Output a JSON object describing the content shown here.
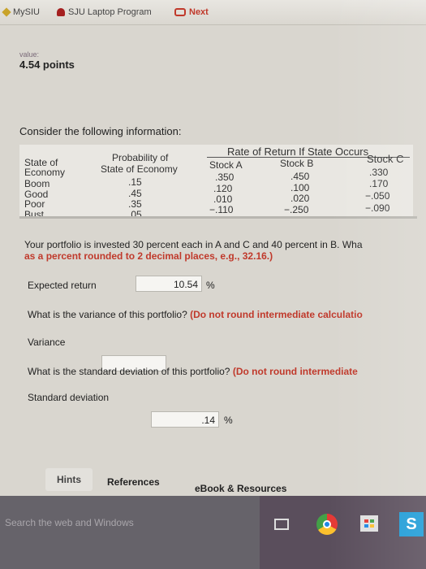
{
  "browser": {
    "tabs": [
      {
        "label": "MySIU"
      },
      {
        "label": "SJU Laptop Program"
      },
      {
        "label": "Next"
      }
    ]
  },
  "score": {
    "label": "value:",
    "value": "4.54 points"
  },
  "problem": {
    "intro": "Consider the following information:",
    "table": {
      "col_state": [
        "State of",
        "Economy"
      ],
      "col_prob": [
        "Probability of",
        "State of Economy"
      ],
      "rate_header": "Rate of Return If State Occurs",
      "stock_headers": [
        "Stock A",
        "Stock B",
        "Stock C"
      ],
      "rows": [
        {
          "state": "Boom",
          "prob": ".15",
          "a": ".350",
          "b": ".450",
          "c": ".330"
        },
        {
          "state": "Good",
          "prob": ".45",
          "a": ".120",
          "b": ".100",
          "c": ".170"
        },
        {
          "state": "Poor",
          "prob": ".35",
          "a": ".010",
          "b": ".020",
          "c": "−.050"
        },
        {
          "state": "Bust",
          "prob": ".05",
          "a": "−.110",
          "b": "−.250",
          "c": "−.090"
        }
      ]
    },
    "portfolio_text": "Your portfolio is invested 30 percent each in A and C and 40 percent in B. Wha",
    "portfolio_note": "as a percent rounded to 2 decimal places, e.g., 32.16.)"
  },
  "answers": {
    "expected": {
      "label": "Expected return",
      "value": "10.54",
      "unit": "%"
    },
    "variance_question": "What is the variance of this portfolio?",
    "variance_note": "(Do not round intermediate calculatio",
    "variance": {
      "label": "Variance",
      "value": ""
    },
    "std_question": "What is the standard deviation of this portfolio?",
    "std_note": "(Do not round intermediate",
    "std": {
      "label": "Standard deviation",
      "value": ".14",
      "unit": "%"
    }
  },
  "footer_buttons": {
    "hints": "Hints",
    "references": "References",
    "ebook": "eBook & Resources"
  },
  "taskbar": {
    "search_placeholder": "Search the web and Windows"
  }
}
